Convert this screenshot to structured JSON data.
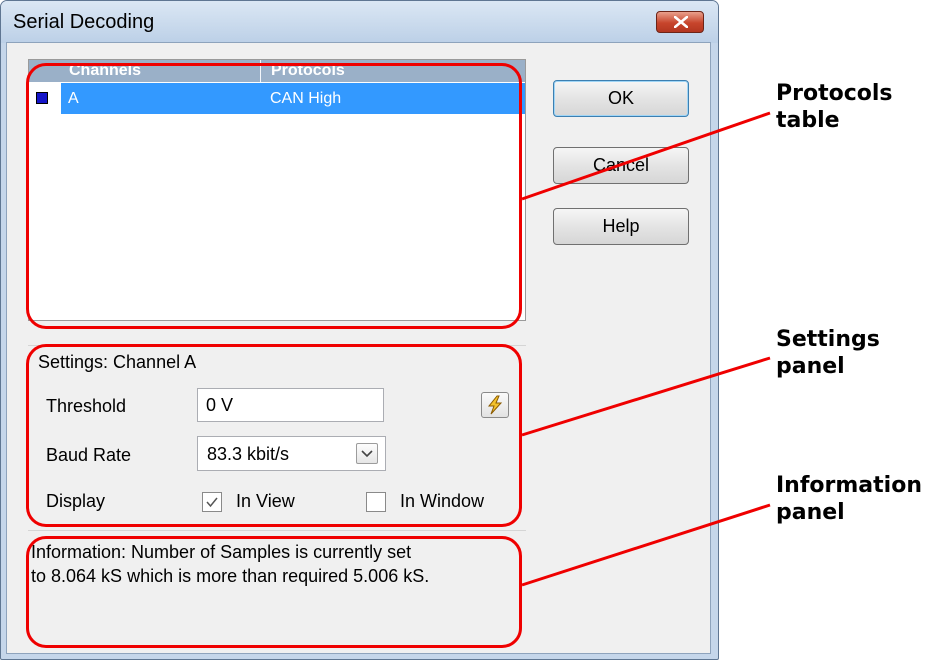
{
  "window": {
    "title": "Serial Decoding",
    "close_icon": "close-x-icon"
  },
  "table": {
    "columns": [
      "Channels",
      "Protocols"
    ],
    "rows": [
      {
        "channel": "A",
        "protocol": "CAN High",
        "swatch_color": "#1515c9",
        "selected": true
      }
    ]
  },
  "buttons": {
    "ok": "OK",
    "cancel": "Cancel",
    "help": "Help"
  },
  "settings": {
    "title": "Settings: Channel A",
    "threshold_label": "Threshold",
    "threshold_value": "0 V",
    "threshold_icon": "lightning-icon",
    "baud_label": "Baud Rate",
    "baud_value": "83.3 kbit/s",
    "display_label": "Display",
    "in_view_label": "In View",
    "in_view_checked": true,
    "in_window_label": "In Window",
    "in_window_checked": false
  },
  "information": {
    "text_line1": "Information: Number of Samples is currently set",
    "text_line2": "to 8.064 kS which is more than required 5.006 kS."
  },
  "annotations": {
    "protocols": [
      "Protocols",
      "table"
    ],
    "settings": [
      "Settings",
      "panel"
    ],
    "information": [
      "Information",
      "panel"
    ],
    "color": "#ef0000"
  }
}
